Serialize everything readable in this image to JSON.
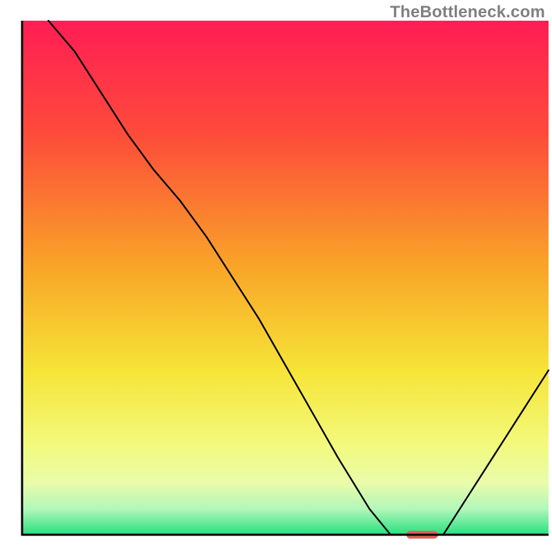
{
  "watermark": "TheBottleneck.com",
  "chart_data": {
    "type": "line",
    "title": "",
    "xlabel": "",
    "ylabel": "",
    "xlim": [
      0,
      100
    ],
    "ylim": [
      0,
      100
    ],
    "background_gradient_stops": [
      {
        "offset": 0,
        "color": "#ff1d55"
      },
      {
        "offset": 22,
        "color": "#fd4b3a"
      },
      {
        "offset": 48,
        "color": "#f9a528"
      },
      {
        "offset": 68,
        "color": "#f6e437"
      },
      {
        "offset": 82,
        "color": "#f3f97a"
      },
      {
        "offset": 90,
        "color": "#e9fcaa"
      },
      {
        "offset": 95,
        "color": "#b2f7ba"
      },
      {
        "offset": 100,
        "color": "#27e07f"
      }
    ],
    "series": [
      {
        "name": "left-curve",
        "stroke": "#000000",
        "x": [
          5.0,
          10,
          15,
          20,
          25,
          30,
          35,
          40,
          45,
          50,
          55,
          60,
          63,
          66,
          70,
          73
        ],
        "values": [
          100,
          94,
          86,
          78,
          71,
          65,
          58,
          50,
          42,
          33,
          24,
          15,
          10,
          5,
          0,
          0
        ]
      },
      {
        "name": "floor-segment",
        "stroke": "#000000",
        "x": [
          73,
          80
        ],
        "values": [
          0,
          0
        ]
      },
      {
        "name": "right-curve",
        "stroke": "#000000",
        "x": [
          80,
          85,
          90,
          95,
          100
        ],
        "values": [
          0,
          8,
          16,
          24,
          32
        ]
      }
    ],
    "marker": {
      "name": "optimal-marker",
      "x": 76,
      "y": 0,
      "width": 6,
      "height": 1.5,
      "color": "#d9605a"
    },
    "frame": {
      "x0": 4,
      "x1": 100,
      "y0": 0,
      "y1": 100,
      "stroke": "#000000"
    }
  }
}
